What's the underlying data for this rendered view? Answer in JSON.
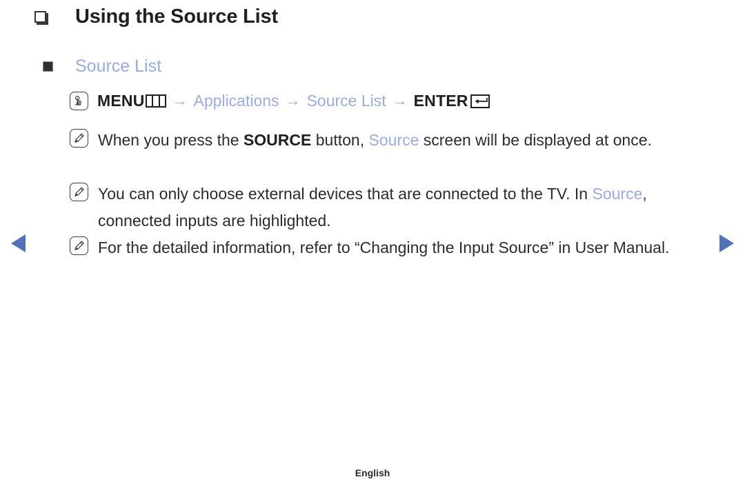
{
  "page": {
    "title": "Using the Source List",
    "subtitle": "Source List",
    "footer_language": "English",
    "accent_color": "#9aabe0",
    "arrow_color": "#5272b8",
    "text_color": "#2d2a2b"
  },
  "menu_path": {
    "icon": "remote-press-icon",
    "menu_label": "MENU",
    "menu_glyph": "menu-bars-icon",
    "arrow_1": "→",
    "applications_label": "Applications",
    "arrow_2": "→",
    "source_list_label": "Source List",
    "arrow_3": "→",
    "enter_label": "ENTER",
    "enter_glyph": "return-arrow-icon"
  },
  "notes": [
    {
      "icon": "note-pencil-icon",
      "parts": [
        {
          "text": "When you press the ",
          "style": "normal"
        },
        {
          "text": "SOURCE",
          "style": "bold"
        },
        {
          "text": " button, ",
          "style": "normal"
        },
        {
          "text": "Source",
          "style": "accent"
        },
        {
          "text": " screen will be displayed at once.",
          "style": "normal"
        }
      ]
    },
    {
      "icon": "note-pencil-icon",
      "parts": [
        {
          "text": "You can only choose external devices that are connected to the TV. In ",
          "style": "normal"
        },
        {
          "text": "Source",
          "style": "accent"
        },
        {
          "text": ", connected inputs are highlighted.",
          "style": "normal"
        }
      ]
    },
    {
      "icon": "note-pencil-icon",
      "parts": [
        {
          "text": "For the detailed information, refer to “Changing the Input Source” in User Manual.",
          "style": "normal"
        }
      ]
    }
  ],
  "nav": {
    "prev_icon": "triangle-left-icon",
    "next_icon": "triangle-right-icon"
  }
}
